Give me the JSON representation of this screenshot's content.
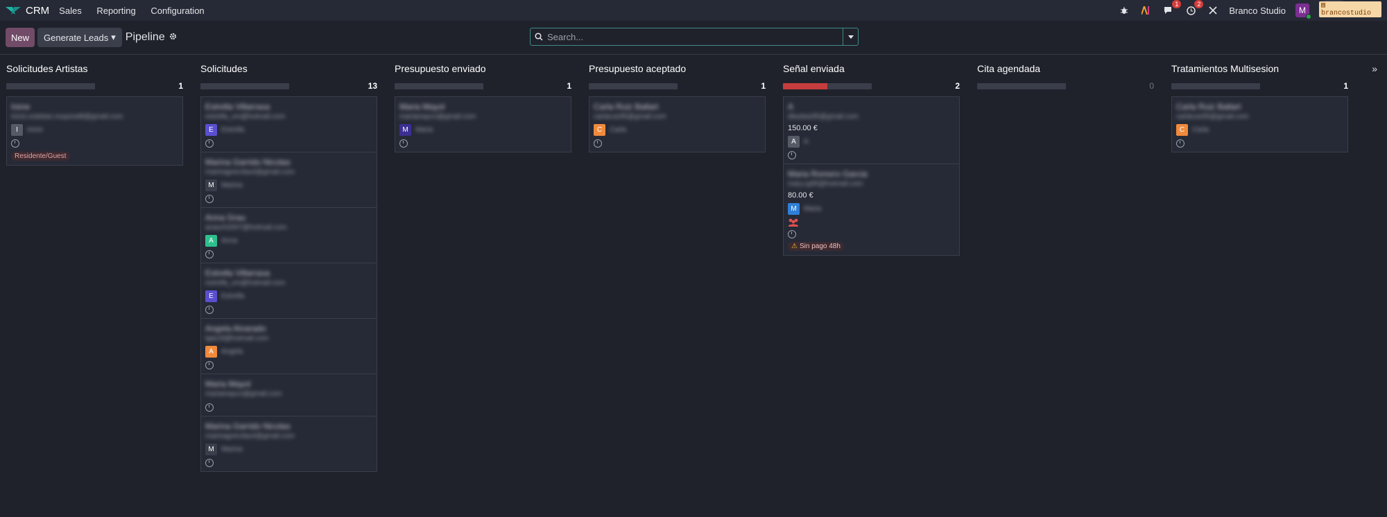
{
  "navbar": {
    "app_name": "CRM",
    "menu": [
      "Sales",
      "Reporting",
      "Configuration"
    ],
    "chat_badge": "1",
    "activity_badge": "2",
    "company": "Branco Studio",
    "user_initial": "M",
    "database": "brancostudio"
  },
  "controls": {
    "new_label": "New",
    "generate_label": "Generate Leads",
    "view_title": "Pipeline",
    "search_placeholder": "Search..."
  },
  "colors": {
    "accent": "#714b67",
    "progress_red": "#c63d3d",
    "background": "#1f222b"
  },
  "columns": [
    {
      "title": "Solicitudes Artistas",
      "count": "1",
      "fill": 0,
      "cards": [
        {
          "name": "Irene",
          "email": "irene.esteban.esquival8@gmail.com",
          "initial": "I",
          "color": "#555a66",
          "owner": "Irene",
          "tag": "Residente/Guest"
        }
      ]
    },
    {
      "title": "Solicitudes",
      "count": "13",
      "fill": 0,
      "cards": [
        {
          "name": "Estrella Villarrasa",
          "email": "estrella_vm@hotmail.com",
          "initial": "E",
          "color": "#5a4fcf",
          "owner": "Estrella"
        },
        {
          "name": "Marina Garrido Nicolas",
          "email": "marinagnicolas4@gmail.com",
          "initial": "M",
          "color": "#3a3e4a",
          "owner": "Marina"
        },
        {
          "name": "Anna Grau",
          "email": "anaurh2007@hotmail.com",
          "initial": "A",
          "color": "#2fbf8f",
          "owner": "Anna"
        },
        {
          "name": "Estrella Villarrasa",
          "email": "estrella_vm@hotmail.com",
          "initial": "E",
          "color": "#5a4fcf",
          "owner": "Estrella"
        },
        {
          "name": "Angela Alvarado",
          "email": "lgarz9@hotmail.com",
          "initial": "A",
          "color": "#f08a3c",
          "owner": "Angela"
        },
        {
          "name": "Maria Mayol",
          "email": "mariamayco@gmail.com"
        },
        {
          "name": "Marina Garrido Nicolas",
          "email": "marinagnicolas4@gmail.com",
          "initial": "M",
          "color": "#3a3e4a",
          "owner": "Marina"
        }
      ]
    },
    {
      "title": "Presupuesto enviado",
      "count": "1",
      "fill": 0,
      "cards": [
        {
          "name": "Maria Mayol",
          "email": "mariamayco@gmail.com",
          "initial": "M",
          "color": "#3b2f91",
          "owner": "Maria"
        }
      ]
    },
    {
      "title": "Presupuesto aceptado",
      "count": "1",
      "fill": 0,
      "cards": [
        {
          "name": "Carla Ruiz Ballart",
          "email": "carlaruiz95@gmail.com",
          "initial": "C",
          "color": "#f08a3c",
          "owner": "Carla"
        }
      ]
    },
    {
      "title": "Señal enviada",
      "count": "2",
      "fill": 0.5,
      "cards": [
        {
          "name": "A",
          "email": "dlaubaz85@gmail.com",
          "amount": "150.00 €",
          "initial": "A",
          "color": "#555a66",
          "owner": "A"
        },
        {
          "name": "Maria Romero Garcia",
          "email": "mary.rg95@hotmail.com",
          "amount": "80.00 €",
          "initial": "M",
          "color": "#2f7fd6",
          "owner": "Maria",
          "people": true,
          "warning": "Sin pago 48h"
        }
      ]
    },
    {
      "title": "Cita agendada",
      "count": "0",
      "fill": 0,
      "cards": []
    },
    {
      "title": "Tratamientos Multisesion",
      "count": "1",
      "fill": 0,
      "cards": [
        {
          "name": "Carla Ruiz Ballart",
          "email": "carlaruiz95@gmail.com",
          "initial": "C",
          "color": "#f08a3c",
          "owner": "Carla"
        }
      ]
    }
  ]
}
